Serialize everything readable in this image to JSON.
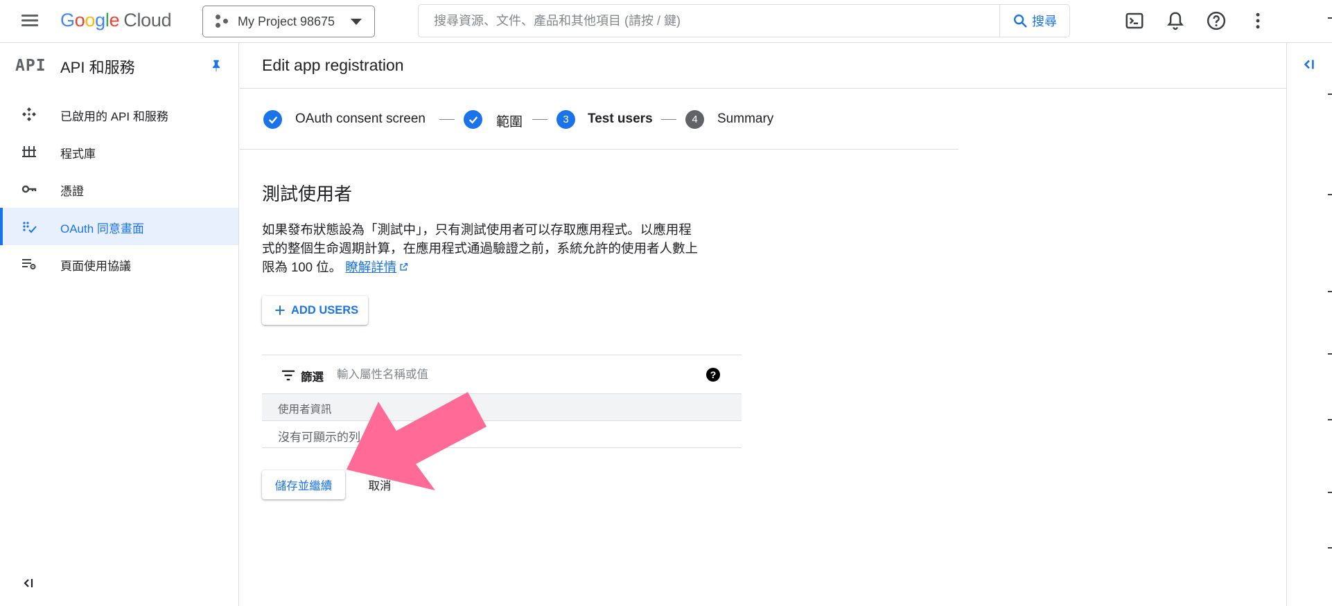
{
  "header": {
    "logo_google": "Google",
    "logo_cloud": "Cloud",
    "project_name": "My Project 98675",
    "search_placeholder": "搜尋資源、文件、產品和其他項目 (請按 / 鍵)",
    "search_button": "搜尋",
    "icons": [
      "menu-icon",
      "project-icon",
      "search-icon",
      "terminal-icon",
      "bell-icon",
      "help-circle-icon",
      "more-vert-icon"
    ]
  },
  "sidebar": {
    "logo": "API",
    "title": "API 和服務",
    "items": [
      {
        "label": "已啟用的 API 和服務",
        "icon": "api-enabled-icon"
      },
      {
        "label": "程式庫",
        "icon": "library-icon"
      },
      {
        "label": "憑證",
        "icon": "key-icon"
      },
      {
        "label": "OAuth 同意畫面",
        "icon": "oauth-consent-icon",
        "active": true
      },
      {
        "label": "頁面使用協議",
        "icon": "page-agreement-icon"
      }
    ]
  },
  "main": {
    "title": "Edit app registration",
    "steps": [
      {
        "label": "OAuth consent screen",
        "state": "done"
      },
      {
        "label": "範圍",
        "state": "done"
      },
      {
        "number": "3",
        "label": "Test users",
        "state": "current"
      },
      {
        "number": "4",
        "label": "Summary",
        "state": "upcoming"
      }
    ],
    "section_title": "測試使用者",
    "description_line1": "如果發布狀態設為「測試中」，只有測試使用者可以存取應用程式。以應用程",
    "description_line2": "式的整個生命週期計算，在應用程式通過驗證之前，系統允許的使用者人數上",
    "description_line3": "限為 100 位。",
    "learn_more": "瞭解詳情",
    "add_users_button": "ADD USERS",
    "filter": {
      "label": "篩選",
      "placeholder": "輸入屬性名稱或值"
    },
    "table": {
      "column_header": "使用者資訊",
      "empty_message": "沒有可顯示的列"
    },
    "save_button": "儲存並繼續",
    "cancel_button": "取消"
  },
  "colors": {
    "accent": "#1a73e8",
    "active_nav_bg": "#e8f0fe",
    "step_done": "#1a73e8",
    "step_upcoming": "#5f6368",
    "annotation_arrow": "#ff6b96"
  }
}
